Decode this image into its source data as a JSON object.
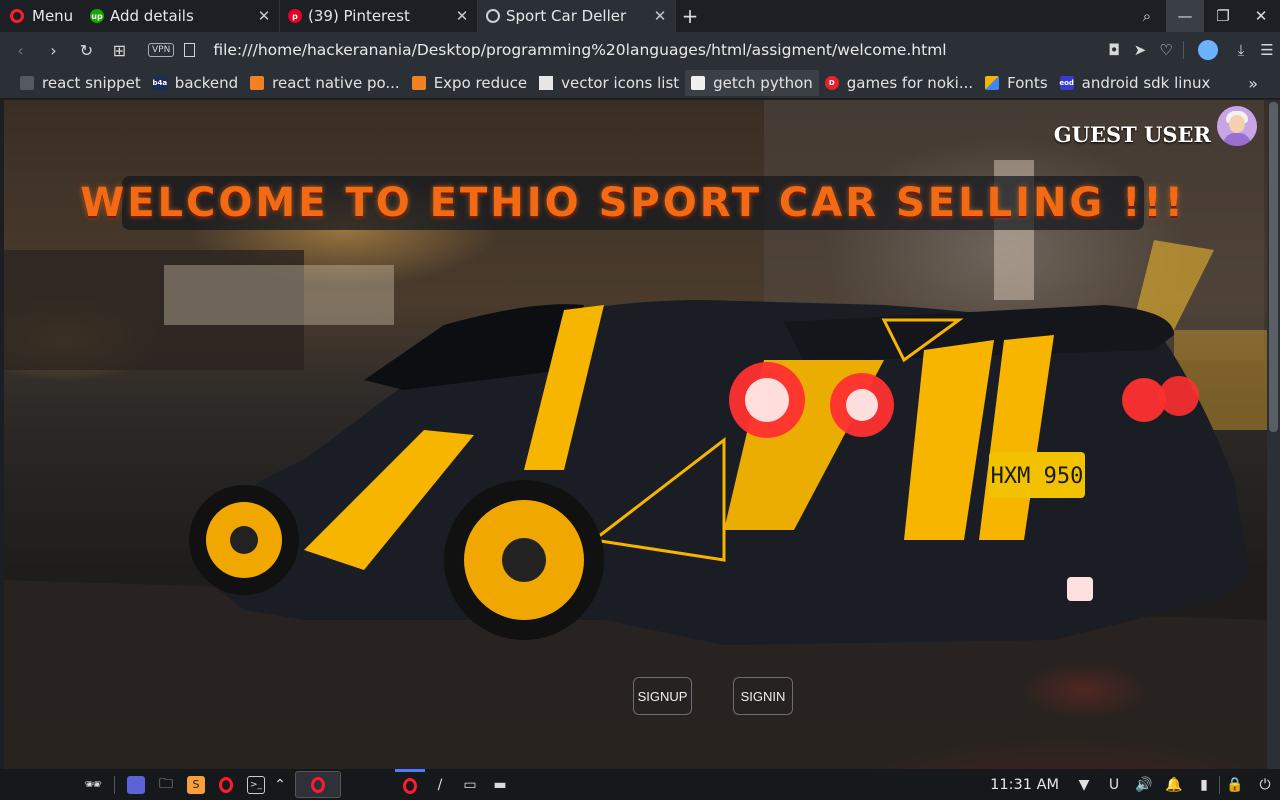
{
  "browser": {
    "menu_label": "Menu",
    "tabs": [
      {
        "title": "Add details",
        "favicon": "upwork-icon"
      },
      {
        "title": "(39) Pinterest",
        "favicon": "pinterest-icon"
      },
      {
        "title": "Sport Car Deller",
        "favicon": "globe-icon",
        "active": true
      }
    ],
    "url": "file:///home/hackeranania/Desktop/programming%20languages/html/assigment/welcome.html",
    "vpn_label": "VPN"
  },
  "bookmarks": [
    {
      "label": "react snippet",
      "icon": "page-icon",
      "color": "#555a60"
    },
    {
      "label": "backend",
      "icon": "b4a-icon",
      "color": "#1d2a5a"
    },
    {
      "label": "react native po...",
      "icon": "stackoverflow-icon",
      "color": "#f48024"
    },
    {
      "label": "Expo reduce",
      "icon": "stackoverflow-icon",
      "color": "#f48024"
    },
    {
      "label": "vector icons list",
      "icon": "document-icon",
      "color": "#e6e6e6"
    },
    {
      "label": "getch python",
      "icon": "cube-icon",
      "color": "#f0f0f0",
      "active": true
    },
    {
      "label": "games for noki...",
      "icon": "dplay-icon",
      "color": "#e8202a"
    },
    {
      "label": "Fonts",
      "icon": "google-fonts-icon",
      "color": "#f4b400"
    },
    {
      "label": "android sdk linux",
      "icon": "eod-icon",
      "color": "#3a3ad0"
    }
  ],
  "page": {
    "guest_label": "GUEST USER",
    "welcome_text": "WELCOME TO ETHIO SPORT CAR SELLING !!!",
    "signup_label": "SIGNUP",
    "signin_label": "SIGNIN",
    "plate_text": "HXM 950"
  },
  "taskbar": {
    "clock": "11:31 AM"
  },
  "colors": {
    "accent_orange": "#f26a14",
    "opera_red": "#ff1b2d",
    "car_yellow": "#f7b500"
  }
}
